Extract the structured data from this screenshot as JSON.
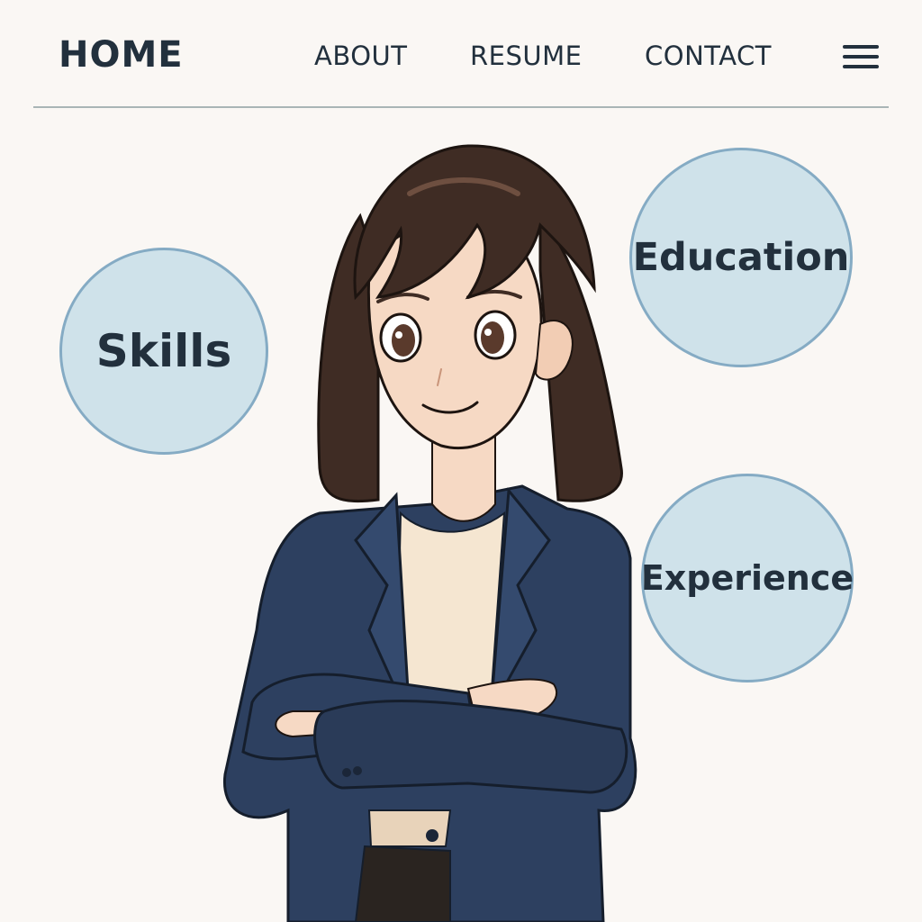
{
  "nav": {
    "brand": "HOME",
    "links": [
      "ABOUT",
      "RESUME",
      "CONTACT"
    ],
    "menu_icon": "hamburger-menu-icon"
  },
  "bubbles": {
    "skills": "Skills",
    "education": "Education",
    "experience": "Experience"
  },
  "colors": {
    "background": "#faf7f4",
    "text": "#22303d",
    "bubble_fill": "#cfe2ea",
    "bubble_border": "#85abc4",
    "blazer": "#2d4060",
    "hair": "#3f2c24",
    "skin": "#f6d9c4"
  }
}
